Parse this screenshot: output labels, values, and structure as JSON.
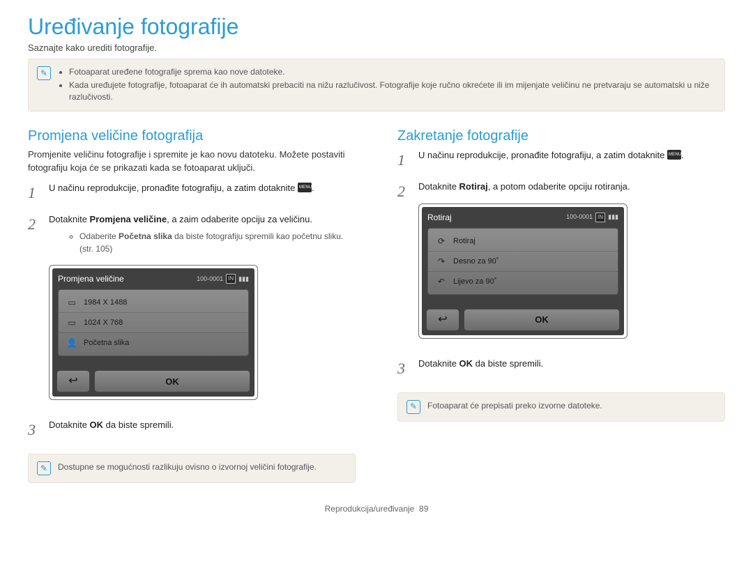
{
  "title": "Uređivanje fotografije",
  "intro": "Saznajte kako urediti fotografije.",
  "top_note": {
    "items": [
      "Fotoaparat uređene fotografije sprema kao nove datoteke.",
      "Kada uređujete fotografije, fotoaparat će ih automatski prebaciti na nižu razlučivost. Fotografije koje ručno okrećete ili im mijenjate veličinu ne pretvaraju se automatski u niže razlučivosti."
    ]
  },
  "left": {
    "heading": "Promjena veličine fotografija",
    "para": "Promjenite veličinu fotografije i spremite je kao novu datoteku. Možete postaviti fotografiju koja će se prikazati kada se fotoaparat uključi.",
    "step1_a": "U načinu reprodukcije, pronađite fotografiju, a zatim dotaknite ",
    "step1_b": ".",
    "step2_a": "Dotaknite ",
    "step2_bold": "Promjena veličine",
    "step2_b": ", a zaim odaberite opciju za veličinu.",
    "step2_sub_a": "Odaberite ",
    "step2_sub_bold": "Početna slika",
    "step2_sub_b": " da biste fotografiju spremili kao početnu sliku. (str. 105)",
    "step3_a": "Dotaknite ",
    "step3_ok": "OK",
    "step3_b": " da biste spremili.",
    "device": {
      "title": "Promjena veličine",
      "status_id": "100-0001",
      "status_badge": "IN",
      "items": [
        {
          "glyph": "▭",
          "label": "1984 X 1488"
        },
        {
          "glyph": "▭",
          "label": "1024 X 768"
        },
        {
          "glyph": "👤",
          "label": "Početna slika"
        }
      ],
      "ok": "OK"
    },
    "bottom_note": "Dostupne se mogućnosti razlikuju ovisno o izvornoj veličini fotografije."
  },
  "right": {
    "heading": "Zakretanje fotografije",
    "step1_a": "U načinu reprodukcije, pronađite fotografiju, a zatim dotaknite ",
    "step1_b": ".",
    "step2_a": "Dotaknite ",
    "step2_bold": "Rotiraj",
    "step2_b": ", a potom odaberite opciju rotiranja.",
    "step3_a": "Dotaknite ",
    "step3_ok": "OK",
    "step3_b": " da biste spremili.",
    "device": {
      "title": "Rotiraj",
      "status_id": "100-0001",
      "status_badge": "IN",
      "items": [
        {
          "glyph": "⟳",
          "label": "Rotiraj"
        },
        {
          "glyph": "↷",
          "label": "Desno za 90˚"
        },
        {
          "glyph": "↶",
          "label": "Lijevo za 90˚"
        }
      ],
      "ok": "OK"
    },
    "bottom_note": "Fotoaparat će prepisati preko izvorne datoteke."
  },
  "footer": {
    "section": "Reprodukcija/uređivanje",
    "page": "89"
  }
}
